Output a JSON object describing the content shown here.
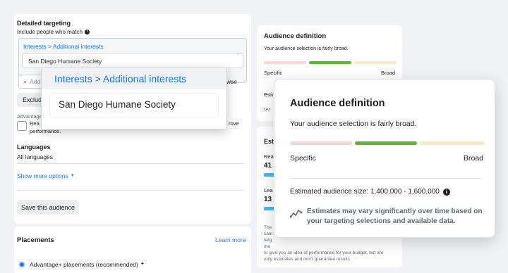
{
  "left": {
    "title": "Detailed targeting",
    "include_label": "Include people who match",
    "breadcrumb": "Interests > Additional interests",
    "selected_item": "San Diego Humane Society",
    "search_placeholder": "Add",
    "browse": "owse",
    "exclude": "Exclud",
    "advantage_label": "Advantage",
    "checkbox_text_1": "Rea",
    "checkbox_text_2": "rove",
    "checkbox_text_3": "performance.",
    "languages_title": "Languages",
    "languages_value": "All languages",
    "show_more": "Show more options",
    "save_button": "Save this audience"
  },
  "placements": {
    "title": "Placements",
    "learn_more": "Learn more",
    "option": "Advantage+ placements (recommended)"
  },
  "right_under": {
    "title": "Audience definition",
    "subtitle": "Your audience selection is fairly broad.",
    "specific": "Specific",
    "broad": "Broad",
    "estim": "Estim",
    "est_partial": "Est",
    "reach_partial": "Rea",
    "num1": "41",
    "lea_partial": "Lea",
    "num2": "13",
    "disclaimer_1": "The",
    "disclaimer_2": "cam",
    "disclaimer_3": "targ",
    "disclaimer_4": "ma",
    "disclaimer_5": "to give you an idea of performance for your budget, but are",
    "disclaimer_6": "only estimates and don't guarantee results."
  },
  "popup_interest": {
    "breadcrumb": "Interests > Additional interests",
    "item": "San Diego Humane Society"
  },
  "popup_audience": {
    "title": "Audience definition",
    "subtitle": "Your audience selection is fairly broad.",
    "specific": "Specific",
    "broad": "Broad",
    "estimated_size": "Estimated audience size: 1,400,000 - 1,600,000",
    "note": "Estimates may vary significantly over time based on your targeting selections and available data."
  },
  "colors": {
    "meter_specific": "#f8d7d3",
    "meter_mid": "#5cb531",
    "meter_broad": "#fbe7c2",
    "accent": "#1877f2"
  }
}
